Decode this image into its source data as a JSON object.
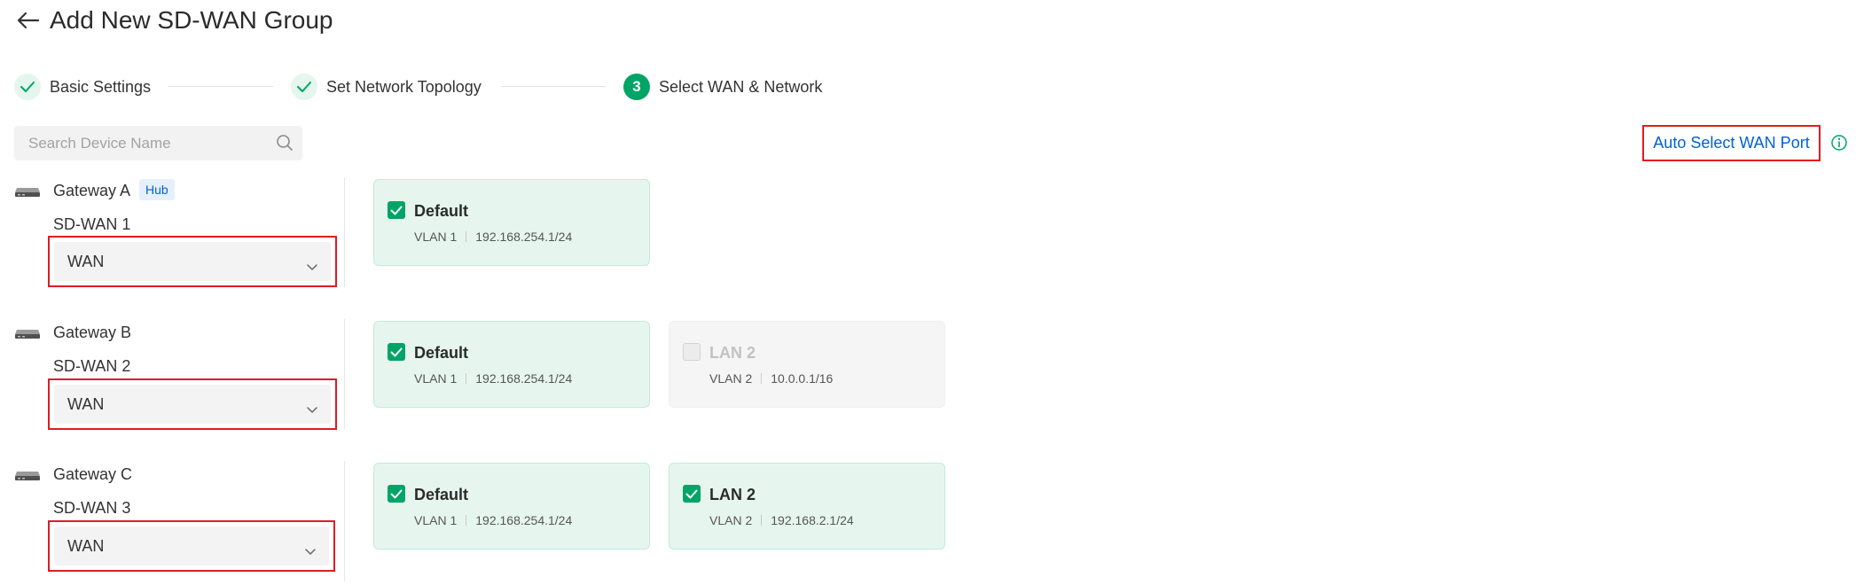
{
  "page": {
    "title": "Add New SD-WAN Group"
  },
  "steps": [
    {
      "label": "Basic Settings",
      "state": "done"
    },
    {
      "label": "Set Network Topology",
      "state": "done"
    },
    {
      "label": "Select WAN & Network",
      "state": "active",
      "number": "3"
    }
  ],
  "search": {
    "placeholder": "Search Device Name",
    "value": ""
  },
  "auto_select": {
    "label": "Auto Select WAN Port"
  },
  "gateways": [
    {
      "name": "Gateway A",
      "badge": "Hub",
      "sdwan": "SD-WAN 1",
      "wan_port": "WAN",
      "networks": [
        {
          "name": "Default",
          "vlan": "VLAN 1",
          "subnet": "192.168.254.1/24",
          "checked": true,
          "enabled": true
        }
      ]
    },
    {
      "name": "Gateway B",
      "sdwan": "SD-WAN 2",
      "wan_port": "WAN",
      "networks": [
        {
          "name": "Default",
          "vlan": "VLAN 1",
          "subnet": "192.168.254.1/24",
          "checked": true,
          "enabled": true
        },
        {
          "name": "LAN 2",
          "vlan": "VLAN 2",
          "subnet": "10.0.0.1/16",
          "checked": false,
          "enabled": false
        }
      ]
    },
    {
      "name": "Gateway C",
      "sdwan": "SD-WAN 3",
      "wan_port": "WAN",
      "networks": [
        {
          "name": "Default",
          "vlan": "VLAN 1",
          "subnet": "192.168.254.1/24",
          "checked": true,
          "enabled": true
        },
        {
          "name": "LAN 2",
          "vlan": "VLAN 2",
          "subnet": "192.168.2.1/24",
          "checked": true,
          "enabled": true
        }
      ]
    }
  ],
  "colors": {
    "accent": "#00a466",
    "link": "#0060d6",
    "highlight": "#e11b22"
  },
  "icons": {
    "back": "arrow-left-icon",
    "step_done": "check-icon",
    "search": "search-icon",
    "info": "info-icon",
    "gateway": "gateway-device-icon",
    "dropdown": "chevron-down-icon"
  }
}
